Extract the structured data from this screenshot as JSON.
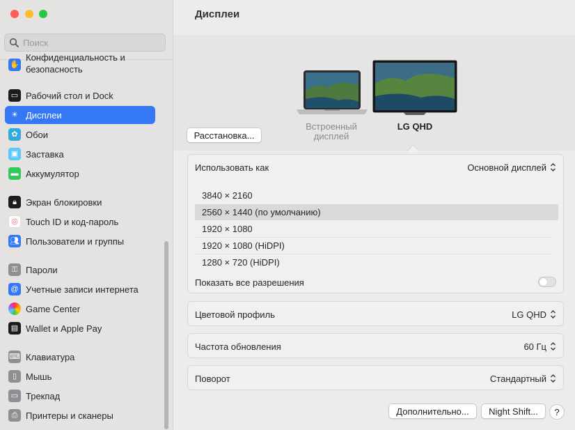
{
  "window": {
    "title": "Дисплеи"
  },
  "search": {
    "placeholder": "Поиск"
  },
  "sidebar": {
    "items": [
      {
        "label": "Конфиденциальность и безопасность",
        "icon": "hand-icon",
        "color": "#3478f6"
      },
      {
        "label": "Рабочий стол и Dock",
        "icon": "desktop-icon",
        "color": "#1c1c1e"
      },
      {
        "label": "Дисплеи",
        "icon": "sun-icon",
        "color": "#3478f6",
        "active": true
      },
      {
        "label": "Обои",
        "icon": "flower-icon",
        "color": "#34aadc"
      },
      {
        "label": "Заставка",
        "icon": "screensaver-icon",
        "color": "#5ac8fa"
      },
      {
        "label": "Аккумулятор",
        "icon": "battery-icon",
        "color": "#34c759"
      },
      {
        "label": "Экран блокировки",
        "icon": "lock-icon",
        "color": "#1c1c1e"
      },
      {
        "label": "Touch ID и код-пароль",
        "icon": "fingerprint-icon",
        "color": "#ff6b6b"
      },
      {
        "label": "Пользователи и группы",
        "icon": "users-icon",
        "color": "#3478f6"
      },
      {
        "label": "Пароли",
        "icon": "key-icon",
        "color": "#8e8e93"
      },
      {
        "label": "Учетные записи интернета",
        "icon": "at-icon",
        "color": "#3478f6"
      },
      {
        "label": "Game Center",
        "icon": "game-center-icon",
        "color": "#ff9500"
      },
      {
        "label": "Wallet и Apple Pay",
        "icon": "wallet-icon",
        "color": "#1c1c1e"
      },
      {
        "label": "Клавиатура",
        "icon": "keyboard-icon",
        "color": "#8e8e93"
      },
      {
        "label": "Мышь",
        "icon": "mouse-icon",
        "color": "#8e8e93"
      },
      {
        "label": "Трекпад",
        "icon": "trackpad-icon",
        "color": "#8e8e93"
      },
      {
        "label": "Принтеры и сканеры",
        "icon": "printer-icon",
        "color": "#8e8e93"
      }
    ]
  },
  "arrangement_button": "Расстановка...",
  "displays": {
    "builtin_label": "Встроенный дисплей",
    "external_label": "LG QHD"
  },
  "use_as": {
    "label": "Использовать как",
    "value": "Основной дисплей"
  },
  "resolutions": [
    "3840 × 2160",
    "2560 × 1440 (по умолчанию)",
    "1920 × 1080",
    "1920 × 1080 (HiDPI)",
    "1280 × 720 (HiDPI)"
  ],
  "show_all": {
    "label": "Показать все разрешения",
    "on": false
  },
  "color_profile": {
    "label": "Цветовой профиль",
    "value": "LG QHD"
  },
  "refresh_rate": {
    "label": "Частота обновления",
    "value": "60 Гц"
  },
  "rotation": {
    "label": "Поворот",
    "value": "Стандартный"
  },
  "footer": {
    "advanced": "Дополнительно...",
    "night_shift": "Night Shift...",
    "help": "?"
  },
  "colors": {
    "accent": "#3478f6",
    "close": "#ff5f57",
    "minimize": "#febc2e",
    "zoom": "#28c840"
  }
}
